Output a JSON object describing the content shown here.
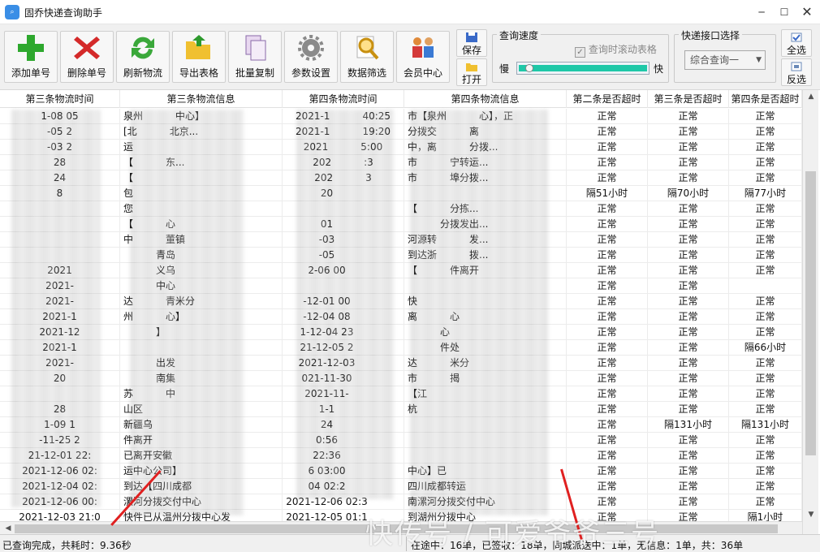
{
  "window": {
    "title": "固乔快递查询助手",
    "icon": "app-icon-text"
  },
  "toolbar": {
    "buttons": [
      {
        "label": "添加单号",
        "icon": "plus-icon"
      },
      {
        "label": "删除单号",
        "icon": "delete-x-icon"
      },
      {
        "label": "刷新物流",
        "icon": "refresh-icon"
      },
      {
        "label": "导出表格",
        "icon": "folder-export-icon"
      },
      {
        "label": "批量复制",
        "icon": "copy-icon"
      },
      {
        "label": "参数设置",
        "icon": "gear-icon"
      },
      {
        "label": "数据筛选",
        "icon": "magnifier-filter-icon"
      },
      {
        "label": "会员中心",
        "icon": "members-icon"
      }
    ],
    "save_label": "保存",
    "open_label": "打开",
    "speed": {
      "title": "查询速度",
      "slow": "慢",
      "fast": "快",
      "scroll_label": "查询时滚动表格",
      "scroll_checked": true,
      "level": 0.05
    },
    "api": {
      "title": "快递接口选择",
      "selected": "综合查询一"
    },
    "select_all_label": "全选",
    "invert_label": "反选"
  },
  "table": {
    "headers": [
      "第三条物流时间",
      "第三条物流信息",
      "第四条物流时间",
      "第四条物流信息",
      "第二条是否超时",
      "第三条是否超时",
      "第四条是否超时"
    ],
    "rows": [
      [
        "1-08 05",
        "泉州",
        "中心】",
        "2021-1",
        "40:25",
        "市【泉州",
        "心】，正",
        "正常",
        "正常",
        "正常"
      ],
      [
        "-05 2",
        "[北",
        "北京...",
        "2021-1",
        "19:20",
        "分拨交",
        "离",
        "正常",
        "正常",
        "正常"
      ],
      [
        "-03 2",
        "运",
        "",
        "2021",
        "5:00",
        "中，离",
        "分拨...",
        "正常",
        "正常",
        "正常"
      ],
      [
        "28",
        "【",
        "东...",
        "202",
        ":3",
        "市",
        "宁转运...",
        "正常",
        "正常",
        "正常"
      ],
      [
        "24",
        "【",
        "",
        "202",
        "3",
        "市",
        "埠分拨...",
        "正常",
        "正常",
        "正常"
      ],
      [
        "8",
        "包",
        "",
        "20",
        "",
        "",
        "",
        "隔51小时",
        "隔70小时",
        "隔77小时"
      ],
      [
        "",
        "您",
        "",
        "",
        "",
        "【",
        "分拣...",
        "正常",
        "正常",
        "正常"
      ],
      [
        "",
        "【",
        "心",
        "01",
        "",
        "",
        "分拨发出...",
        "正常",
        "正常",
        "正常"
      ],
      [
        "",
        "中",
        "董镇",
        "-03",
        "",
        "河源转",
        "发...",
        "正常",
        "正常",
        "正常"
      ],
      [
        "",
        "",
        "青岛",
        "-05",
        "",
        "到达浙",
        "拨...",
        "正常",
        "正常",
        "正常"
      ],
      [
        "2021",
        "",
        "义乌",
        "2-06 00",
        "",
        "【",
        "件离开",
        "正常",
        "正常",
        "正常"
      ],
      [
        "2021-",
        "",
        "中心",
        "",
        "",
        "",
        "",
        "正常",
        "正常",
        ""
      ],
      [
        "2021-",
        "达",
        "青米分",
        "-12-01 00",
        "",
        "快",
        "",
        "正常",
        "正常",
        "正常"
      ],
      [
        "2021-1",
        "州",
        "心】",
        "-12-04 08",
        "",
        "离",
        "心",
        "正常",
        "正常",
        "正常"
      ],
      [
        "2021-12",
        "",
        "】",
        "1-12-04 23",
        "",
        "",
        "心",
        "正常",
        "正常",
        "正常"
      ],
      [
        "2021-1",
        "",
        "",
        "21-12-05 2",
        "",
        "",
        "件处",
        "正常",
        "正常",
        "隔66小时"
      ],
      [
        "2021-",
        "",
        "出发",
        "2021-12-03",
        "",
        "达",
        "米分",
        "正常",
        "正常",
        "正常"
      ],
      [
        "20",
        "",
        "南集",
        "021-11-30",
        "",
        "市",
        "揭",
        "正常",
        "正常",
        "正常"
      ],
      [
        "",
        "苏",
        "中",
        "2021-11-",
        "",
        "【江",
        "",
        "正常",
        "正常",
        "正常"
      ],
      [
        "28",
        "山区",
        "",
        "1-1",
        "",
        "杭",
        "",
        "正常",
        "正常",
        "正常"
      ],
      [
        "1-09 1",
        "新疆乌",
        "",
        "24",
        "",
        "",
        "",
        "正常",
        "隔131小时",
        "隔131小时"
      ],
      [
        "-11-25 2",
        "件离开",
        "",
        "0:56",
        "",
        "",
        "",
        "正常",
        "正常",
        "正常"
      ],
      [
        "21-12-01 22:",
        "已离开安徽",
        "",
        "22:36",
        "",
        "",
        "",
        "正常",
        "正常",
        "正常"
      ],
      [
        "2021-12-06 02:",
        "运中心公司】",
        "",
        "6 03:00",
        "",
        "中心】已",
        "",
        "正常",
        "正常",
        "正常"
      ],
      [
        "2021-12-04 02:",
        "到达【四川成都",
        "",
        "04 02:2",
        "",
        "四川成都转运",
        "",
        "正常",
        "正常",
        "正常"
      ],
      [
        "2021-12-06 00:",
        "漯河分拨交付中心",
        "",
        "2021-12-06 02:3",
        "",
        "南漯河分拨交付中心",
        "",
        "正常",
        "正常",
        "正常"
      ],
      [
        "2021-12-03 21:0",
        "快件已从温州分拨中心发",
        "",
        "2021-12-05 01:1",
        "",
        "到湖州分拨中心",
        "",
        "正常",
        "正常",
        "隔1小时"
      ]
    ]
  },
  "status": {
    "left": "已查询完成，共耗时：9.36秒",
    "right": "在途中：16单，已签收：18单，同城派送中：1单，无信息：1单，共：36单"
  },
  "overlay": {
    "watermark": "快传号 / 可爱爷爷三号"
  }
}
